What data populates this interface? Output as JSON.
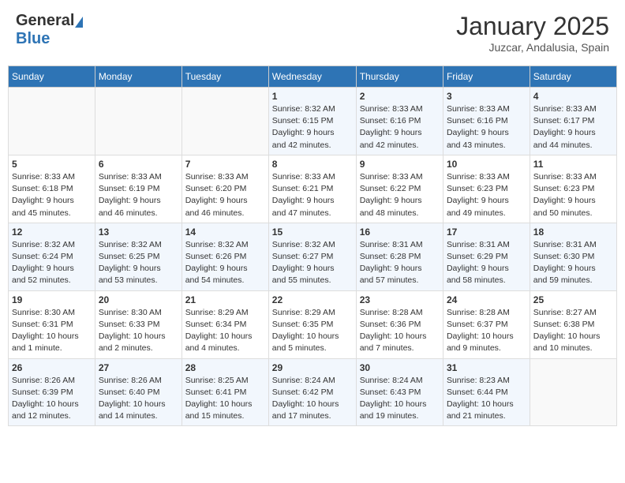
{
  "header": {
    "logo_general": "General",
    "logo_blue": "Blue",
    "month_title": "January 2025",
    "location": "Juzcar, Andalusia, Spain"
  },
  "days_of_week": [
    "Sunday",
    "Monday",
    "Tuesday",
    "Wednesday",
    "Thursday",
    "Friday",
    "Saturday"
  ],
  "weeks": [
    [
      {
        "day": "",
        "info": ""
      },
      {
        "day": "",
        "info": ""
      },
      {
        "day": "",
        "info": ""
      },
      {
        "day": "1",
        "info": "Sunrise: 8:32 AM\nSunset: 6:15 PM\nDaylight: 9 hours\nand 42 minutes."
      },
      {
        "day": "2",
        "info": "Sunrise: 8:33 AM\nSunset: 6:16 PM\nDaylight: 9 hours\nand 42 minutes."
      },
      {
        "day": "3",
        "info": "Sunrise: 8:33 AM\nSunset: 6:16 PM\nDaylight: 9 hours\nand 43 minutes."
      },
      {
        "day": "4",
        "info": "Sunrise: 8:33 AM\nSunset: 6:17 PM\nDaylight: 9 hours\nand 44 minutes."
      }
    ],
    [
      {
        "day": "5",
        "info": "Sunrise: 8:33 AM\nSunset: 6:18 PM\nDaylight: 9 hours\nand 45 minutes."
      },
      {
        "day": "6",
        "info": "Sunrise: 8:33 AM\nSunset: 6:19 PM\nDaylight: 9 hours\nand 46 minutes."
      },
      {
        "day": "7",
        "info": "Sunrise: 8:33 AM\nSunset: 6:20 PM\nDaylight: 9 hours\nand 46 minutes."
      },
      {
        "day": "8",
        "info": "Sunrise: 8:33 AM\nSunset: 6:21 PM\nDaylight: 9 hours\nand 47 minutes."
      },
      {
        "day": "9",
        "info": "Sunrise: 8:33 AM\nSunset: 6:22 PM\nDaylight: 9 hours\nand 48 minutes."
      },
      {
        "day": "10",
        "info": "Sunrise: 8:33 AM\nSunset: 6:23 PM\nDaylight: 9 hours\nand 49 minutes."
      },
      {
        "day": "11",
        "info": "Sunrise: 8:33 AM\nSunset: 6:23 PM\nDaylight: 9 hours\nand 50 minutes."
      }
    ],
    [
      {
        "day": "12",
        "info": "Sunrise: 8:32 AM\nSunset: 6:24 PM\nDaylight: 9 hours\nand 52 minutes."
      },
      {
        "day": "13",
        "info": "Sunrise: 8:32 AM\nSunset: 6:25 PM\nDaylight: 9 hours\nand 53 minutes."
      },
      {
        "day": "14",
        "info": "Sunrise: 8:32 AM\nSunset: 6:26 PM\nDaylight: 9 hours\nand 54 minutes."
      },
      {
        "day": "15",
        "info": "Sunrise: 8:32 AM\nSunset: 6:27 PM\nDaylight: 9 hours\nand 55 minutes."
      },
      {
        "day": "16",
        "info": "Sunrise: 8:31 AM\nSunset: 6:28 PM\nDaylight: 9 hours\nand 57 minutes."
      },
      {
        "day": "17",
        "info": "Sunrise: 8:31 AM\nSunset: 6:29 PM\nDaylight: 9 hours\nand 58 minutes."
      },
      {
        "day": "18",
        "info": "Sunrise: 8:31 AM\nSunset: 6:30 PM\nDaylight: 9 hours\nand 59 minutes."
      }
    ],
    [
      {
        "day": "19",
        "info": "Sunrise: 8:30 AM\nSunset: 6:31 PM\nDaylight: 10 hours\nand 1 minute."
      },
      {
        "day": "20",
        "info": "Sunrise: 8:30 AM\nSunset: 6:33 PM\nDaylight: 10 hours\nand 2 minutes."
      },
      {
        "day": "21",
        "info": "Sunrise: 8:29 AM\nSunset: 6:34 PM\nDaylight: 10 hours\nand 4 minutes."
      },
      {
        "day": "22",
        "info": "Sunrise: 8:29 AM\nSunset: 6:35 PM\nDaylight: 10 hours\nand 5 minutes."
      },
      {
        "day": "23",
        "info": "Sunrise: 8:28 AM\nSunset: 6:36 PM\nDaylight: 10 hours\nand 7 minutes."
      },
      {
        "day": "24",
        "info": "Sunrise: 8:28 AM\nSunset: 6:37 PM\nDaylight: 10 hours\nand 9 minutes."
      },
      {
        "day": "25",
        "info": "Sunrise: 8:27 AM\nSunset: 6:38 PM\nDaylight: 10 hours\nand 10 minutes."
      }
    ],
    [
      {
        "day": "26",
        "info": "Sunrise: 8:26 AM\nSunset: 6:39 PM\nDaylight: 10 hours\nand 12 minutes."
      },
      {
        "day": "27",
        "info": "Sunrise: 8:26 AM\nSunset: 6:40 PM\nDaylight: 10 hours\nand 14 minutes."
      },
      {
        "day": "28",
        "info": "Sunrise: 8:25 AM\nSunset: 6:41 PM\nDaylight: 10 hours\nand 15 minutes."
      },
      {
        "day": "29",
        "info": "Sunrise: 8:24 AM\nSunset: 6:42 PM\nDaylight: 10 hours\nand 17 minutes."
      },
      {
        "day": "30",
        "info": "Sunrise: 8:24 AM\nSunset: 6:43 PM\nDaylight: 10 hours\nand 19 minutes."
      },
      {
        "day": "31",
        "info": "Sunrise: 8:23 AM\nSunset: 6:44 PM\nDaylight: 10 hours\nand 21 minutes."
      },
      {
        "day": "",
        "info": ""
      }
    ]
  ]
}
